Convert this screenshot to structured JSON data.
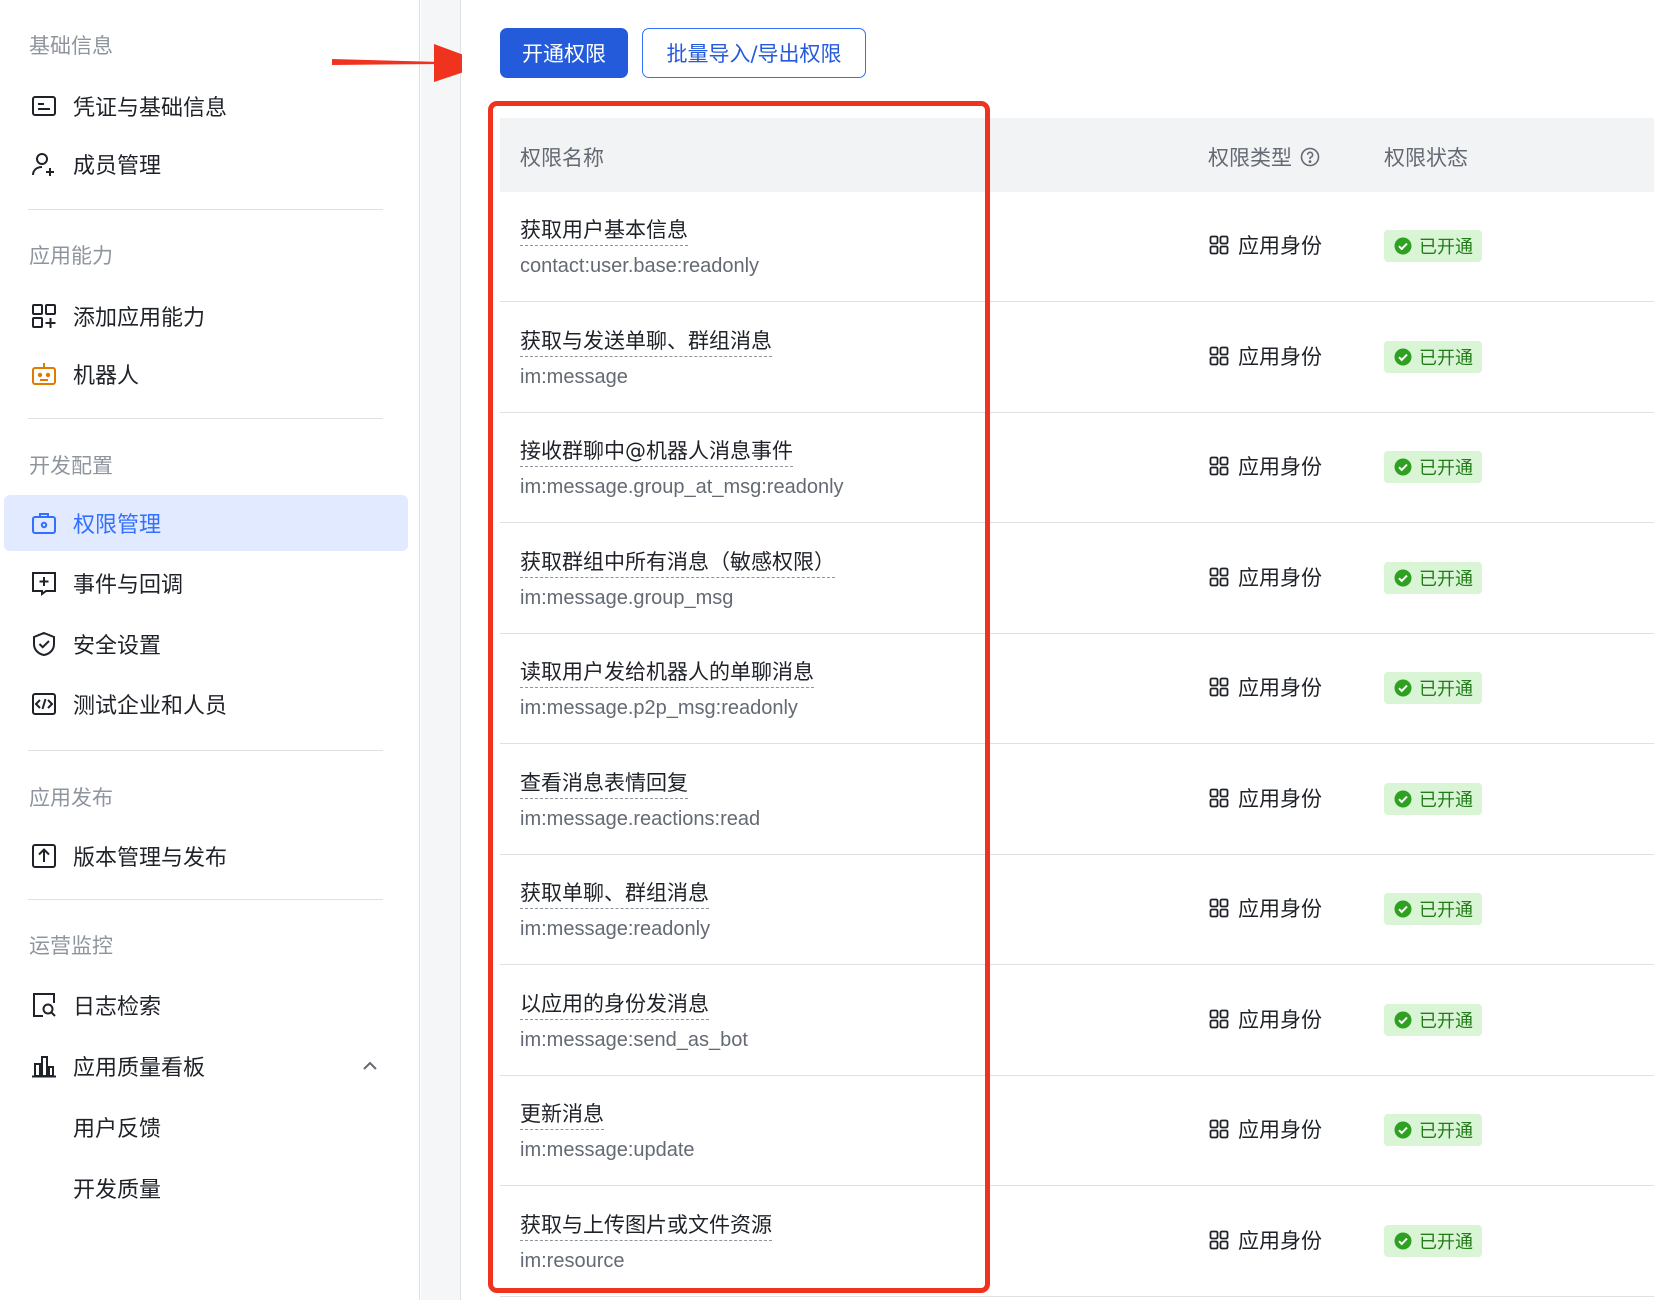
{
  "sidebar": {
    "sections": [
      {
        "title": "基础信息",
        "items": [
          {
            "label": "凭证与基础信息",
            "icon": "credential-card-icon"
          },
          {
            "label": "成员管理",
            "icon": "user-add-icon"
          }
        ]
      },
      {
        "title": "应用能力",
        "items": [
          {
            "label": "添加应用能力",
            "icon": "grid-add-icon"
          },
          {
            "label": "机器人",
            "icon": "robot-icon"
          }
        ]
      },
      {
        "title": "开发配置",
        "items": [
          {
            "label": "权限管理",
            "icon": "permission-bag-icon",
            "active": true
          },
          {
            "label": "事件与回调",
            "icon": "event-plus-icon"
          },
          {
            "label": "安全设置",
            "icon": "shield-check-icon"
          },
          {
            "label": "测试企业和人员",
            "icon": "code-brackets-icon"
          }
        ]
      },
      {
        "title": "应用发布",
        "items": [
          {
            "label": "版本管理与发布",
            "icon": "upload-icon"
          }
        ]
      },
      {
        "title": "运营监控",
        "items": [
          {
            "label": "日志检索",
            "icon": "log-search-icon"
          },
          {
            "label": "应用质量看板",
            "icon": "bar-chart-icon",
            "expanded": true
          }
        ],
        "subitems": [
          "用户反馈",
          "开发质量"
        ]
      }
    ]
  },
  "toolbar": {
    "primary_label": "开通权限",
    "secondary_label": "批量导入/导出权限"
  },
  "table": {
    "columns": [
      "权限名称",
      "权限类型",
      "权限状态"
    ],
    "rows": [
      {
        "name": "获取用户基本信息",
        "scope": "contact:user.base:readonly",
        "type": "应用身份",
        "status": "已开通"
      },
      {
        "name": "获取与发送单聊、群组消息",
        "scope": "im:message",
        "type": "应用身份",
        "status": "已开通"
      },
      {
        "name": "接收群聊中@机器人消息事件",
        "scope": "im:message.group_at_msg:readonly",
        "type": "应用身份",
        "status": "已开通"
      },
      {
        "name": "获取群组中所有消息（敏感权限）",
        "scope": "im:message.group_msg",
        "type": "应用身份",
        "status": "已开通"
      },
      {
        "name": "读取用户发给机器人的单聊消息",
        "scope": "im:message.p2p_msg:readonly",
        "type": "应用身份",
        "status": "已开通"
      },
      {
        "name": "查看消息表情回复",
        "scope": "im:message.reactions:read",
        "type": "应用身份",
        "status": "已开通"
      },
      {
        "name": "获取单聊、群组消息",
        "scope": "im:message:readonly",
        "type": "应用身份",
        "status": "已开通"
      },
      {
        "name": "以应用的身份发消息",
        "scope": "im:message:send_as_bot",
        "type": "应用身份",
        "status": "已开通"
      },
      {
        "name": "更新消息",
        "scope": "im:message:update",
        "type": "应用身份",
        "status": "已开通"
      },
      {
        "name": "获取与上传图片或文件资源",
        "scope": "im:resource",
        "type": "应用身份",
        "status": "已开通"
      }
    ]
  },
  "colors": {
    "accent": "#3370ff",
    "primary_button": "#245bdb",
    "annotation_red": "#f0331f",
    "status_green": "#237b19"
  }
}
